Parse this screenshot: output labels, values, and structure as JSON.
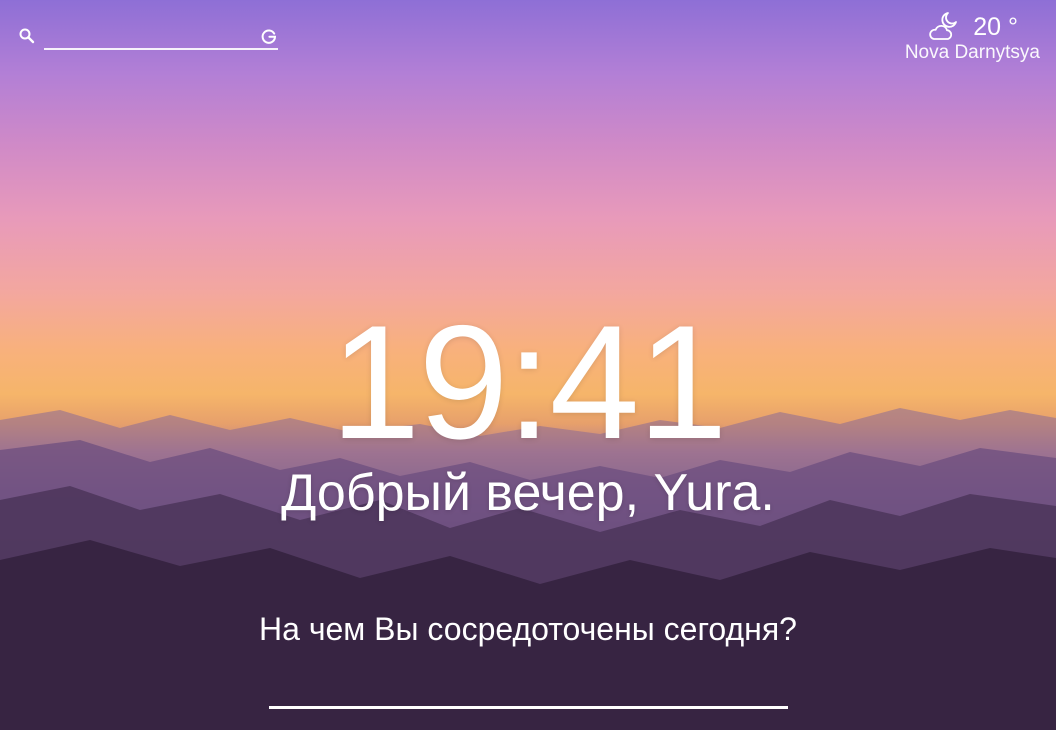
{
  "search": {
    "placeholder": "",
    "value": ""
  },
  "weather": {
    "icon": "partly-cloudy-night-icon",
    "temperature": "20 °",
    "location": "Nova Darnytsya"
  },
  "clock": {
    "time": "19:41"
  },
  "greeting": {
    "text": "Добрый вечер, Yura."
  },
  "focus": {
    "prompt": "На чем Вы сосредоточены сегодня?",
    "value": ""
  }
}
